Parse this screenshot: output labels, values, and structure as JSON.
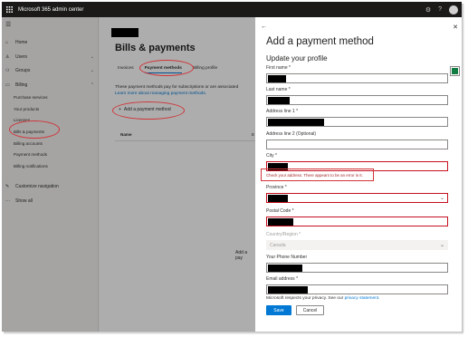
{
  "topbar": {
    "title": "Microsoft 365 admin center"
  },
  "nav": {
    "home": "Home",
    "users": "Users",
    "groups": "Groups",
    "billing": "Billing",
    "billing_items": [
      "Purchase services",
      "Your products",
      "Licenses",
      "Bills & payments",
      "Billing accounts",
      "Payment methods",
      "Billing notifications"
    ],
    "customize": "Customize navigation",
    "show_all": "Show all"
  },
  "main": {
    "title": "Bills & payments",
    "tabs": [
      "Invoices",
      "Payment methods",
      "Billing profile"
    ],
    "desc_line1": "These payment methods pay for subscriptions or are associated",
    "desc_link": "Learn more about managing payment methods.",
    "add_button": "Add a payment method",
    "col_name": "Name",
    "col_e": "E",
    "add_pay_fragment": "Add a pay"
  },
  "panel": {
    "back": "←",
    "close": "✕",
    "title": "Add a payment method",
    "subtitle": "Update your profile",
    "fields": {
      "first_name": "First name *",
      "last_name": "Last name *",
      "address1": "Address line 1 *",
      "address2": "Address line 2 (Optional)",
      "city": "City *",
      "province": "Province *",
      "postal": "Postal Code *",
      "country": "Country/Region *",
      "phone": "Your Phone Number",
      "email": "Email address *"
    },
    "country_value": "Canada",
    "error": "Check your address. There appears to be an error in it.",
    "privacy_text": "Microsoft respects your privacy. See our ",
    "privacy_link": "privacy statement.",
    "save": "Save",
    "cancel": "Cancel"
  },
  "colors": {
    "accent": "#0078d4",
    "error": "#a4262c",
    "annotation": "#d13438",
    "topbar": "#1b1a19"
  }
}
